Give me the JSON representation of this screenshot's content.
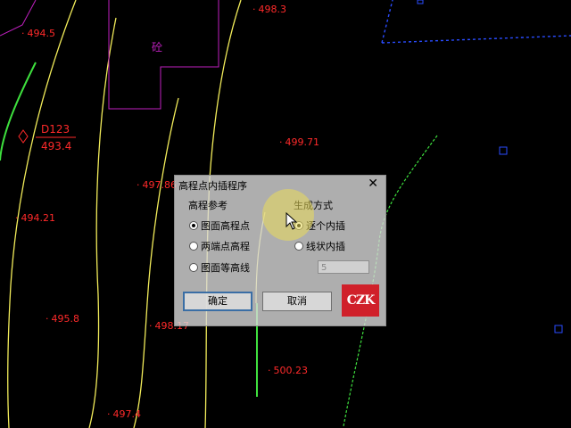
{
  "map": {
    "elevations": [
      "494.5",
      "498.3",
      "499.71",
      "497.86",
      "494.21",
      "495.8",
      "498.17",
      "500.23",
      "497.4"
    ],
    "point_id": "D123",
    "point_elev": "493.4",
    "building_label": "砼",
    "colors": {
      "contour_yellow": "#f2ec5a",
      "contour_green": "#3ee03e",
      "elev_red": "#ff2a2a",
      "building_magenta": "#c020c0",
      "boundary_blue": "#2a4cff"
    }
  },
  "dialog": {
    "title": "高程点内插程序",
    "close_label": "✕",
    "ref_group": {
      "title": "高程参考",
      "options": [
        {
          "label": "图面高程点",
          "selected": true
        },
        {
          "label": "两端点高程",
          "selected": false
        },
        {
          "label": "图面等高线",
          "selected": false
        }
      ]
    },
    "mode_group": {
      "title": "生成方式",
      "options": [
        {
          "label": "逐个内插",
          "selected": true
        },
        {
          "label": "线状内插",
          "selected": false
        }
      ]
    },
    "density_value": "5",
    "ok_label": "确定",
    "cancel_label": "取消",
    "logo_text": "CZK"
  }
}
